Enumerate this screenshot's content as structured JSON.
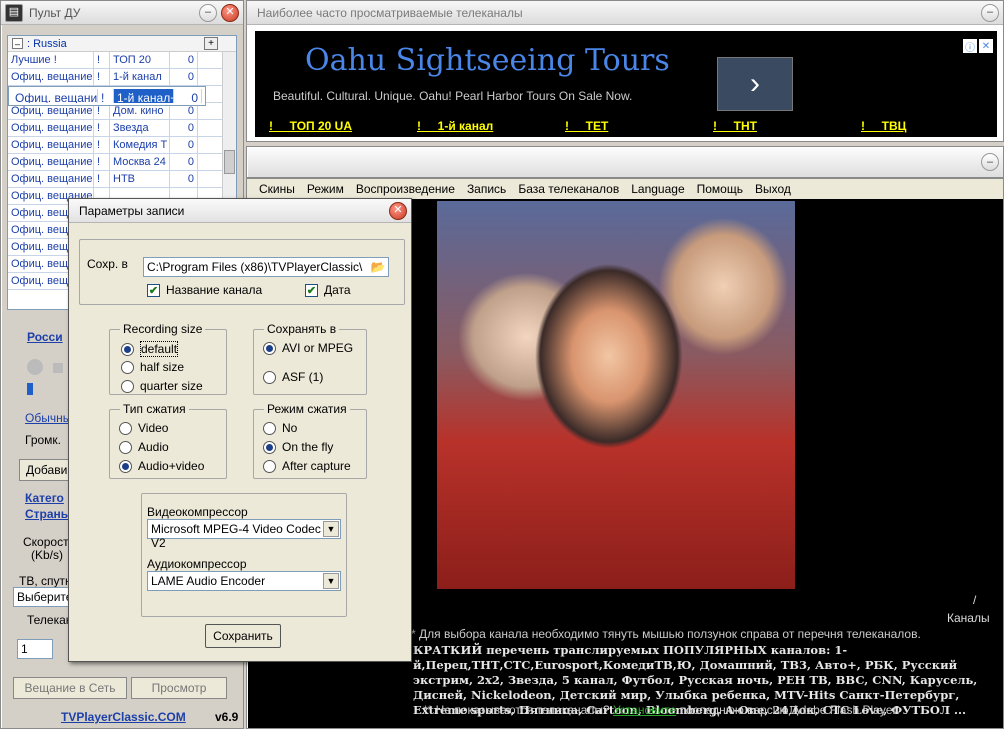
{
  "remote": {
    "title": "Пульт ДУ",
    "list_header": ": Russia",
    "channels": [
      {
        "cat": "Лучшие !",
        "mark": "!",
        "name": "ТОП 20",
        "n": "0"
      },
      {
        "cat": "Офиц. вещание",
        "mark": "!",
        "name": "1-й канал",
        "n": "0"
      },
      {
        "cat": "Офиц. вещание",
        "mark": "!",
        "name": "1-й канал+",
        "n": "0"
      },
      {
        "cat": "Офиц. вещание",
        "mark": "!",
        "name": "5",
        "n": "0"
      },
      {
        "cat": "Офиц. вещание",
        "mark": "!",
        "name": "Дом. кино",
        "n": "0"
      },
      {
        "cat": "Офиц. вещание",
        "mark": "!",
        "name": "Звезда",
        "n": "0"
      },
      {
        "cat": "Офиц. вещание",
        "mark": "!",
        "name": "Комедия Т",
        "n": "0"
      },
      {
        "cat": "Офиц. вещание",
        "mark": "!",
        "name": "Москва 24",
        "n": "0"
      },
      {
        "cat": "Офиц. вещание",
        "mark": "!",
        "name": "НТВ",
        "n": "0"
      },
      {
        "cat": "Офиц. вещание",
        "mark": "",
        "name": "",
        "n": ""
      },
      {
        "cat": "Офиц. вещание",
        "mark": "",
        "name": "",
        "n": ""
      },
      {
        "cat": "Офиц. вещание",
        "mark": "",
        "name": "",
        "n": ""
      },
      {
        "cat": "Офиц. вещание",
        "mark": "",
        "name": "",
        "n": ""
      },
      {
        "cat": "Офиц. вещание",
        "mark": "",
        "name": "",
        "n": ""
      },
      {
        "cat": "Офиц. вещание",
        "mark": "",
        "name": "",
        "n": ""
      }
    ],
    "russia_link": "Росси",
    "normal_link": "Обычны",
    "volume_label": "Громк.",
    "add_button": "Добави",
    "category_link": "Катего",
    "country_link": "Страны",
    "speed_label": "Скорость",
    "speed_unit": "(Kb/s)",
    "tv_group": "ТВ, спутни",
    "select_value": "Выберите",
    "tele_label": "Телекан",
    "stepper_value": "1",
    "broadcast_button": "Вещание в Сеть",
    "preview_button": "Просмотр",
    "footer_link": "TVPlayerClassic.COM",
    "version": "v6.9"
  },
  "topwin": {
    "title": "Наиболее часто просматриваемые телеканалы",
    "ad_headline": "Oahu Sightseeing Tours",
    "ad_sub": "Beautiful. Cultural. Unique. Oahu! Pearl Harbor Tours On Sale Now.",
    "ad_arrow": "›",
    "links": [
      "!     ТОП 20 UA",
      "!     1-й канал",
      "!     ТЕТ",
      "!     ТНТ",
      "!     ТВЦ"
    ]
  },
  "player": {
    "menu": [
      "Скины",
      "Режим",
      "Воспроизведение",
      "Запись",
      "База телеканалов",
      "Language",
      "Помощь",
      "Выход"
    ],
    "slash": "/",
    "channels_label": "Каналы",
    "hint": "* Для выбора канала необходимо тянуть мышью ползунок справа от перечня телеканалов.",
    "brief": "КРАТКИЙ перечень транслируемых ПОПУЛЯРНЫХ каналов: 1-й,Перец,ТНТ,СТС,Eurosport,КомедиТВ,Ю, Домашний, ТВ3, Авто+, РБК, Русский экстрим, 2х2, Звезда, 5 канал, Футбол, Русская ночь, РЕН ТВ, BBC, CNN, Карусель, Дисней, Nickelodeon, Детский мир, Улыбка ребенка, MTV-Hits Санкт-Петербург, Extreme sports, Пятница, Cartoon, Bloomberg, A-One, 24Док, СТС Love, ФУТБОЛ ...",
    "flash_pre": "** Не показываются телеканалы? ",
    "flash_link": "Установите",
    "flash_post": " последнюю версию Adobe Flash Player"
  },
  "dialog": {
    "title": "Параметры записи",
    "save_to_label": "Сохр. в",
    "path": "C:\\Program Files (x86)\\TVPlayerClassic\\",
    "chk_channel": "Название канала",
    "chk_date": "Дата",
    "rec_size": {
      "title": "Recording size",
      "opts": [
        "default",
        "half size",
        "quarter size"
      ]
    },
    "save_as": {
      "title": "Сохранять в",
      "opts": [
        "AVI or MPEG",
        "ASF (1)"
      ]
    },
    "compress_type": {
      "title": "Тип сжатия",
      "opts": [
        "Video",
        "Audio",
        "Audio+video"
      ]
    },
    "compress_mode": {
      "title": "Режим сжатия",
      "opts": [
        "No",
        "On the fly",
        "After capture"
      ]
    },
    "video_comp_label": "Видеокомпрессор",
    "video_comp_value": "Microsoft MPEG-4 Video Codec V2",
    "audio_comp_label": "Аудиокомпрессор",
    "audio_comp_value": "LAME Audio Encoder",
    "save_button": "Сохранить"
  }
}
